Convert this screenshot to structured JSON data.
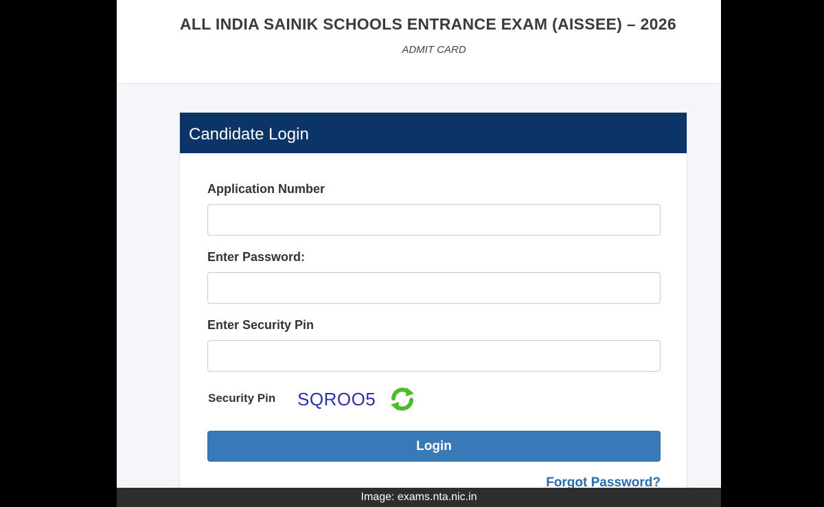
{
  "header": {
    "title": "ALL INDIA SAINIK SCHOOLS ENTRANCE EXAM (AISSEE) – 2026",
    "subtitle": "ADMIT CARD"
  },
  "login_panel": {
    "heading": "Candidate Login",
    "application_number": {
      "label": "Application Number",
      "value": ""
    },
    "password": {
      "label": "Enter Password:",
      "value": ""
    },
    "security_pin_input": {
      "label": "Enter Security Pin",
      "value": ""
    },
    "captcha": {
      "label": "Security Pin",
      "code": "SQROO5",
      "refresh_icon": "refresh-icon"
    },
    "login_button": "Login",
    "forgot_password": "Forgot Password?"
  },
  "caption": "Image: exams.nta.nic.in",
  "colors": {
    "panel_header": "#0d3466",
    "login_button": "#3979b8",
    "captcha_text": "#2c2fa8",
    "refresh_icon": "#4cbb2c",
    "link": "#2a6aa8"
  }
}
